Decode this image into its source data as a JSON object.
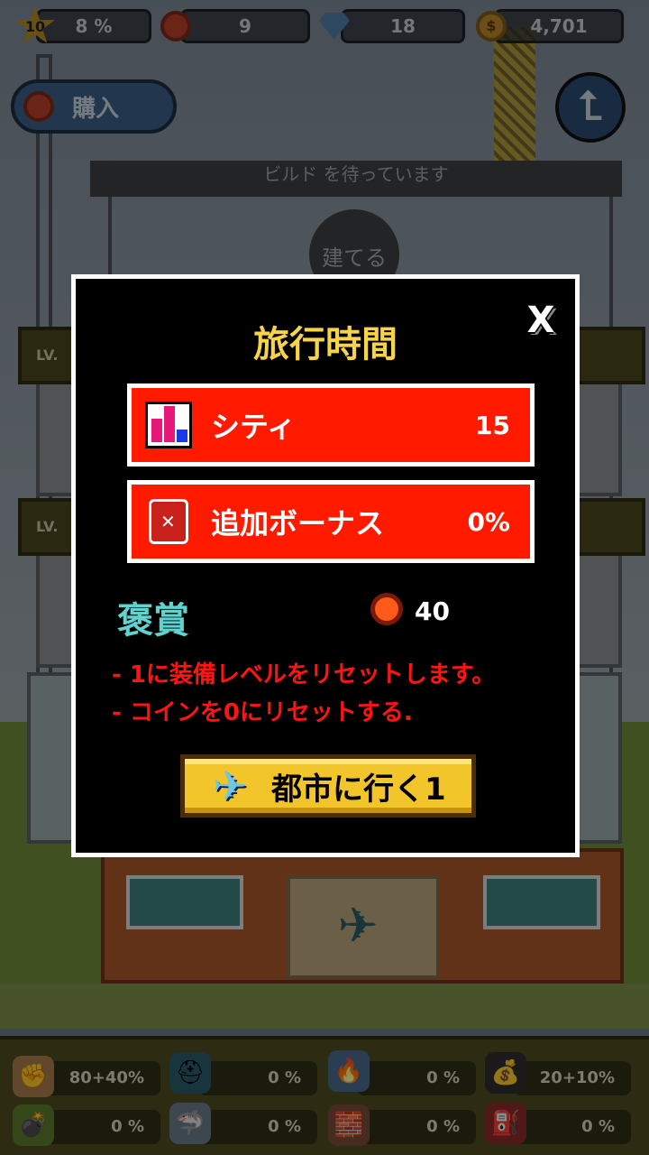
{
  "hud": {
    "level": "10",
    "progress": "8 %",
    "chips": "9",
    "gems": "18",
    "coins": "4,701"
  },
  "buttons": {
    "buy": "購入",
    "build": "建てる"
  },
  "building": {
    "waiting_text": "ビルド を待っています",
    "lv_label_1": "LV.",
    "lv_label_2": "LV."
  },
  "modal": {
    "title": "旅行時間",
    "close": "X",
    "rows": [
      {
        "icon": "city-bars-icon",
        "label": "シティ",
        "value": "15"
      },
      {
        "icon": "bonus-can-icon",
        "label": "追加ボーナス",
        "value": "0%"
      }
    ],
    "reward_label": "褒賞",
    "reward_value": "40",
    "warnings": [
      "- 1に装備レベルをリセットします。",
      "- コインを0にリセットする."
    ],
    "go_button": "都市に行く1"
  },
  "stats": [
    {
      "icon": "fist-icon",
      "value": "80+40%"
    },
    {
      "icon": "helmet-icon",
      "value": "0 %"
    },
    {
      "icon": "flame-hero-icon",
      "value": "0 %"
    },
    {
      "icon": "money-bag-icon",
      "value": "20+10%"
    },
    {
      "icon": "grenade-icon",
      "value": "0 %"
    },
    {
      "icon": "shark-icon",
      "value": "0 %"
    },
    {
      "icon": "bricks-icon",
      "value": "0 %"
    },
    {
      "icon": "fuel-can-icon",
      "value": "0 %"
    }
  ],
  "colors": {
    "modal_row": "#ff1a00",
    "title": "#f7d34a",
    "reward_label": "#5fd3cf",
    "warning": "#ff1414",
    "go_button": "#f2c62a"
  }
}
